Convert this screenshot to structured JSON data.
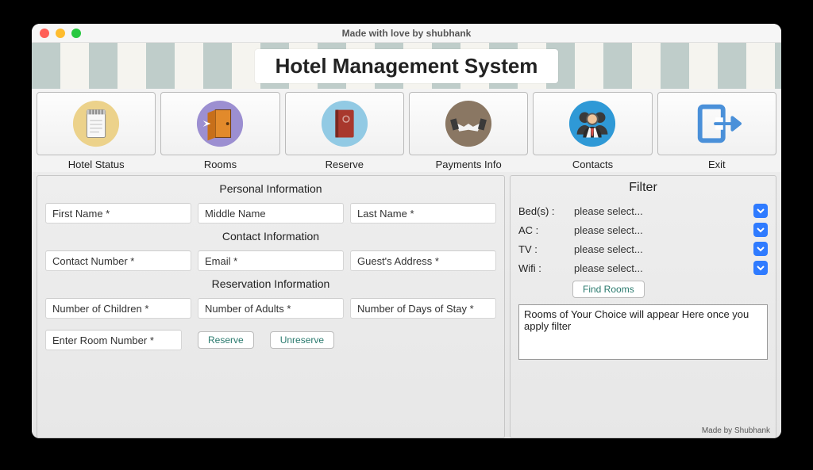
{
  "window": {
    "title": "Made with love by shubhank"
  },
  "app_title": "Hotel Management System",
  "nav": [
    {
      "label": "Hotel Status"
    },
    {
      "label": "Rooms"
    },
    {
      "label": "Reserve"
    },
    {
      "label": "Payments Info"
    },
    {
      "label": "Contacts"
    },
    {
      "label": "Exit"
    }
  ],
  "form": {
    "section_personal": "Personal Information",
    "first_name_ph": "First Name *",
    "middle_name_ph": "Middle Name",
    "last_name_ph": "Last Name *",
    "section_contact": "Contact Information",
    "contact_number_ph": "Contact Number *",
    "email_ph": "Email *",
    "address_ph": "Guest's Address *",
    "section_reservation": "Reservation Information",
    "children_ph": "Number of Children *",
    "adults_ph": "Number of Adults *",
    "days_ph": "Number of Days of Stay *",
    "room_ph": "Enter Room Number *",
    "reserve_btn": "Reserve",
    "unreserve_btn": "Unreserve"
  },
  "filter": {
    "title": "Filter",
    "labels": {
      "beds": "Bed(s) :",
      "ac": "AC :",
      "tv": "TV :",
      "wifi": "Wifi :"
    },
    "placeholder": "please select...",
    "find_btn": "Find Rooms",
    "results_text": "Rooms of Your Choice will appear Here once you apply filter"
  },
  "footer": "Made by Shubhank"
}
